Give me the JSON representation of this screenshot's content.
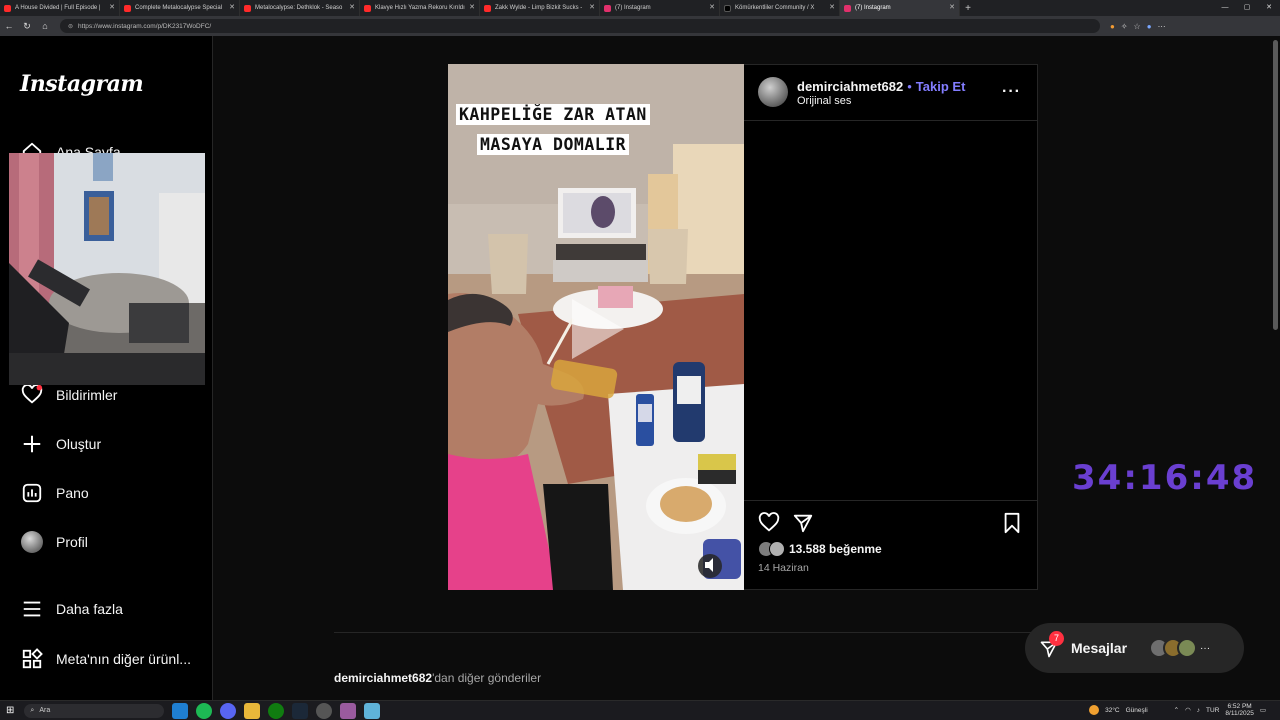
{
  "browser": {
    "tabs": [
      {
        "label": "A House Divided | Full Episode |",
        "color": "#ff2a2a",
        "active": false
      },
      {
        "label": "Complete Metalocalypse Special",
        "color": "#ff2a2a",
        "active": false
      },
      {
        "label": "Metalocalypse: Dethklok - Seaso",
        "color": "#ff2a2a",
        "active": false
      },
      {
        "label": "Klavye Hızlı Yazma Rekoru Kırıldı",
        "color": "#ff2a2a",
        "active": false
      },
      {
        "label": "Zakk Wylde - Limp Bizkit Sucks -",
        "color": "#ff2a2a",
        "active": false
      },
      {
        "label": "(7) Instagram",
        "color": "#e1306c",
        "active": false
      },
      {
        "label": "Kömürkentliler Community / X",
        "color": "#000000",
        "active": false
      },
      {
        "label": "(7) Instagram",
        "color": "#e1306c",
        "active": true
      }
    ],
    "url": "https://www.instagram.com/p/DK2317WoDFC/"
  },
  "sidebar": {
    "logo": "Instagram",
    "items": [
      {
        "label": "Ana Sayfa",
        "icon": "home-icon"
      },
      {
        "label": "Bildirimler",
        "icon": "heart-icon"
      },
      {
        "label": "Oluştur",
        "icon": "plus-icon"
      },
      {
        "label": "Pano",
        "icon": "chart-icon"
      },
      {
        "label": "Profil",
        "icon": "avatar"
      },
      {
        "label": "Daha fazla",
        "icon": "menu-icon"
      },
      {
        "label": "Meta'nın diğer ürünl...",
        "icon": "grid-icon"
      }
    ]
  },
  "post": {
    "overlay_line1": "KAHPELİĞE ZAR ATAN",
    "overlay_line2": "MASAYA DOMALIR",
    "username": "demirciahmet682",
    "follow_sep": "•",
    "follow_label": "Takip Et",
    "audio": "Orijinal ses",
    "likes": "13.588 beğenme",
    "date": "14 Haziran"
  },
  "more_posts": {
    "username": "demirciahmet682",
    "suffix": "'dan diğer gönderiler"
  },
  "clock": "34:16:48",
  "messages": {
    "label": "Mesajlar",
    "badge": "7",
    "more": "···"
  },
  "taskbar": {
    "search_placeholder": "Ara",
    "weather": "32°C",
    "weather_desc": "Güneşli",
    "lang": "TUR",
    "time": "6:52 PM",
    "date": "8/11/2025"
  },
  "colors": {
    "accent_link": "#837dff",
    "clock": "#6a3fd1",
    "badge": "#ff3040"
  }
}
